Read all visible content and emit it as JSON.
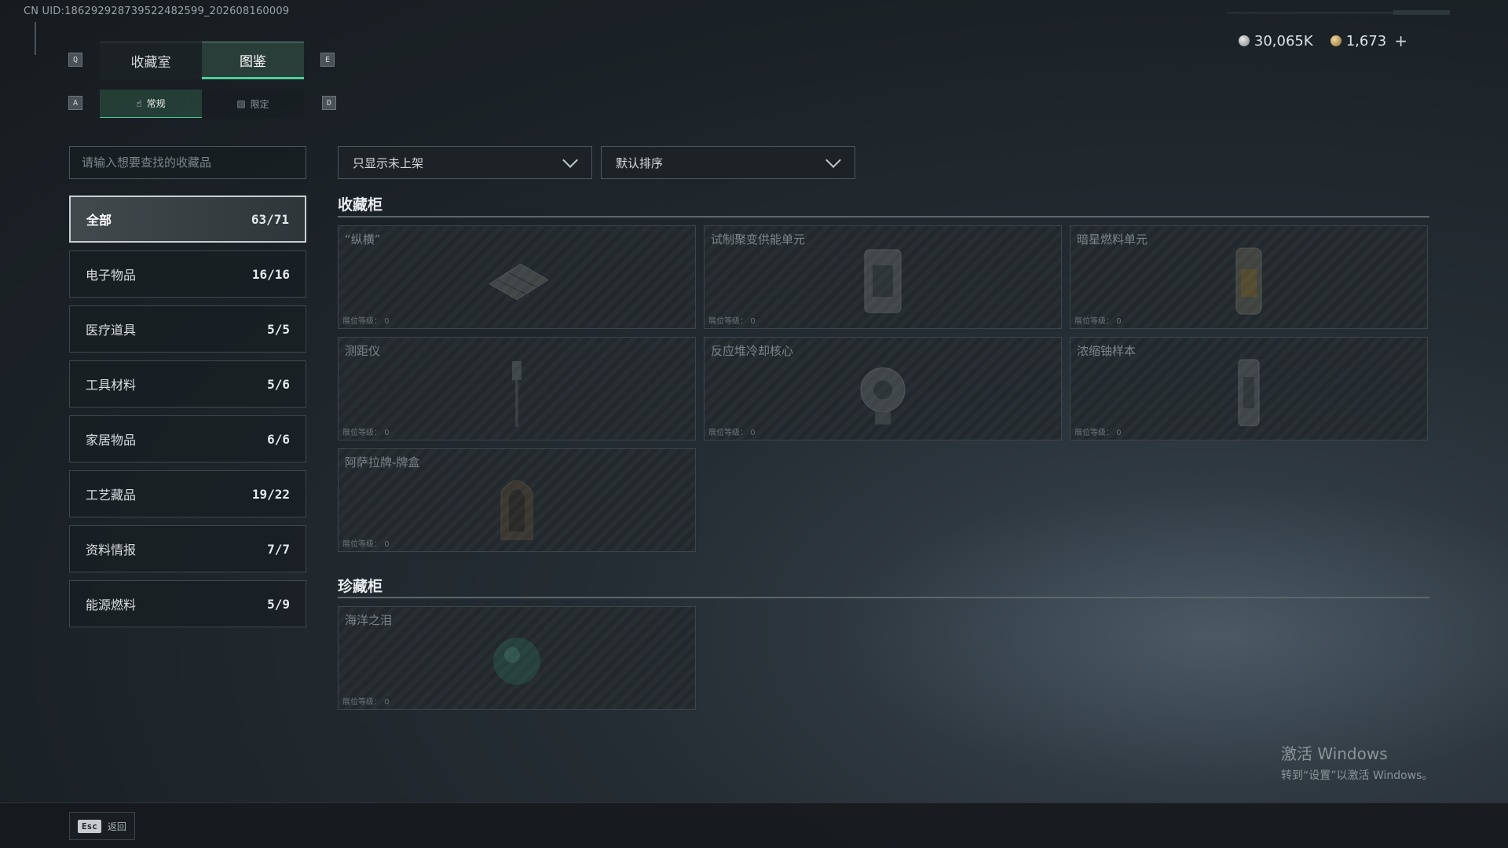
{
  "header": {
    "uid": "CN UID:1862929287395224825​99_202608160009",
    "currency": [
      {
        "icon": "silver-coin-icon",
        "value": "30,065K"
      },
      {
        "icon": "gold-coin-icon",
        "value": "1,673"
      }
    ],
    "plus_label": "+"
  },
  "keys": {
    "prev_tab": "Q",
    "next_tab": "E",
    "prev_sub": "A",
    "next_sub": "D"
  },
  "tabs": [
    {
      "label": "收藏室",
      "active": false
    },
    {
      "label": "图鉴",
      "active": true
    }
  ],
  "subtabs": [
    {
      "label": "常规",
      "icon": "hand-icon",
      "active": true
    },
    {
      "label": "限定",
      "icon": "image-icon",
      "active": false
    }
  ],
  "search": {
    "placeholder": "请输入想要查找的收藏品"
  },
  "categories": [
    {
      "label": "全部",
      "count": "63/71",
      "active": true
    },
    {
      "label": "电子物品",
      "count": "16/16"
    },
    {
      "label": "医疗道具",
      "count": "5/5"
    },
    {
      "label": "工具材料",
      "count": "5/6"
    },
    {
      "label": "家居物品",
      "count": "6/6"
    },
    {
      "label": "工艺藏品",
      "count": "19/22"
    },
    {
      "label": "资料情报",
      "count": "7/7"
    },
    {
      "label": "能源燃料",
      "count": "5/9"
    }
  ],
  "filters": {
    "shelf_filter": "只显示未上架",
    "sort": "默认排序"
  },
  "sections": [
    {
      "title": "收藏柜",
      "items": [
        {
          "name": "“纵横”",
          "level_label": "展位等级：",
          "level": "0"
        },
        {
          "name": "试制聚变供能单元",
          "level_label": "展位等级：",
          "level": "0"
        },
        {
          "name": "暗星燃料单元",
          "level_label": "展位等级：",
          "level": "0"
        },
        {
          "name": "测距仪",
          "level_label": "展位等级：",
          "level": "0"
        },
        {
          "name": "反应堆冷却核心",
          "level_label": "展位等级：",
          "level": "0"
        },
        {
          "name": "浓缩铀样本",
          "level_label": "展位等级：",
          "level": "0"
        },
        {
          "name": "阿萨拉牌-牌盒",
          "level_label": "展位等级：",
          "level": "0"
        }
      ]
    },
    {
      "title": "珍藏柜",
      "items": [
        {
          "name": "海洋之泪",
          "level_label": "展位等级：",
          "level": "0"
        }
      ]
    }
  ],
  "footer": {
    "esc_key": "Esc",
    "back_label": "返回"
  },
  "watermark": {
    "line1": "激活 Windows",
    "line2": "转到“设置”以激活 Windows。"
  },
  "colors": {
    "accent": "#4ecf9a",
    "background": "#1b2227"
  }
}
